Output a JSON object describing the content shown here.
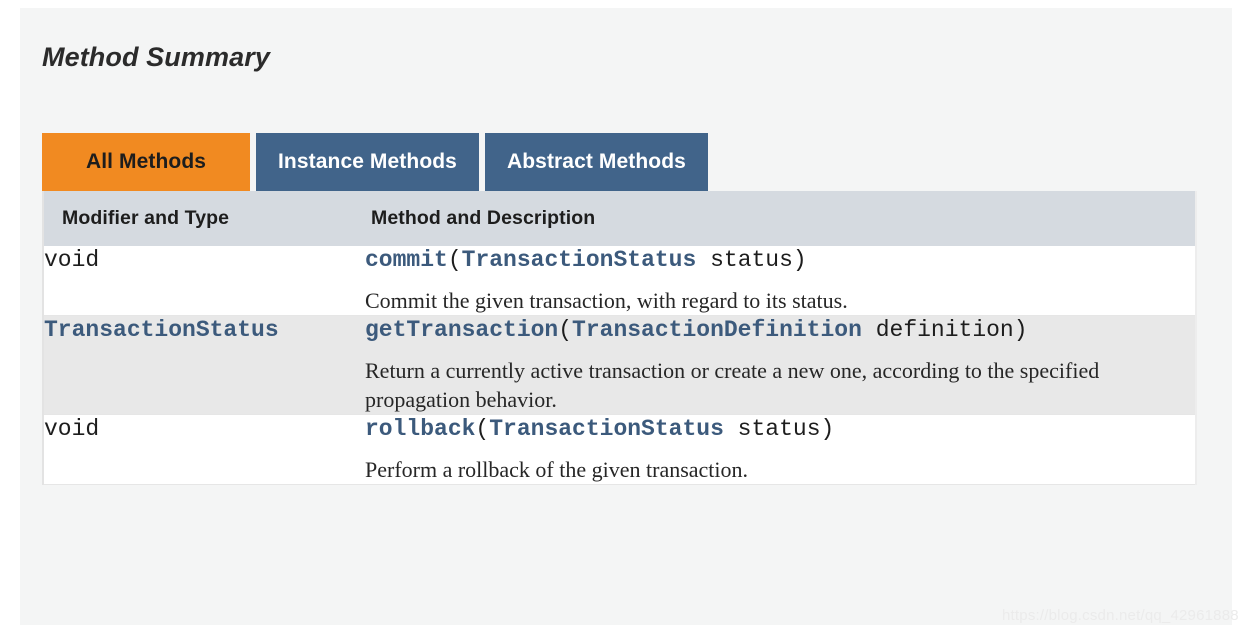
{
  "page": {
    "title": "Method Summary",
    "watermark": "https://blog.csdn.net/qq_42961888"
  },
  "colors": {
    "tab_active_bg": "#f18a21",
    "tab_inactive_bg": "#41648a",
    "table_header_bg": "#d5dae0",
    "link": "#3c5a7c",
    "row_alt_bg": "#e8e8e8",
    "panel_bg": "#f4f5f5"
  },
  "tabs": [
    {
      "label": "All Methods",
      "active": true
    },
    {
      "label": "Instance Methods",
      "active": false
    },
    {
      "label": "Abstract Methods",
      "active": false
    }
  ],
  "table": {
    "headers": {
      "modifier": "Modifier and Type",
      "method": "Method and Description"
    },
    "rows": [
      {
        "modifier": "void",
        "modifier_is_link": false,
        "method_name": "commit",
        "open_paren": "(",
        "param_type": "TransactionStatus",
        "param_name": " status",
        "close_paren": ")",
        "description": "Commit the given transaction, with regard to its status."
      },
      {
        "modifier": "TransactionStatus",
        "modifier_is_link": true,
        "method_name": "getTransaction",
        "open_paren": "(",
        "param_type": "TransactionDefinition",
        "param_name": " definition",
        "close_paren": ")",
        "description": "Return a currently active transaction or create a new one, according to the specified propagation behavior."
      },
      {
        "modifier": "void",
        "modifier_is_link": false,
        "method_name": "rollback",
        "open_paren": "(",
        "param_type": "TransactionStatus",
        "param_name": " status",
        "close_paren": ")",
        "description": "Perform a rollback of the given transaction."
      }
    ]
  }
}
